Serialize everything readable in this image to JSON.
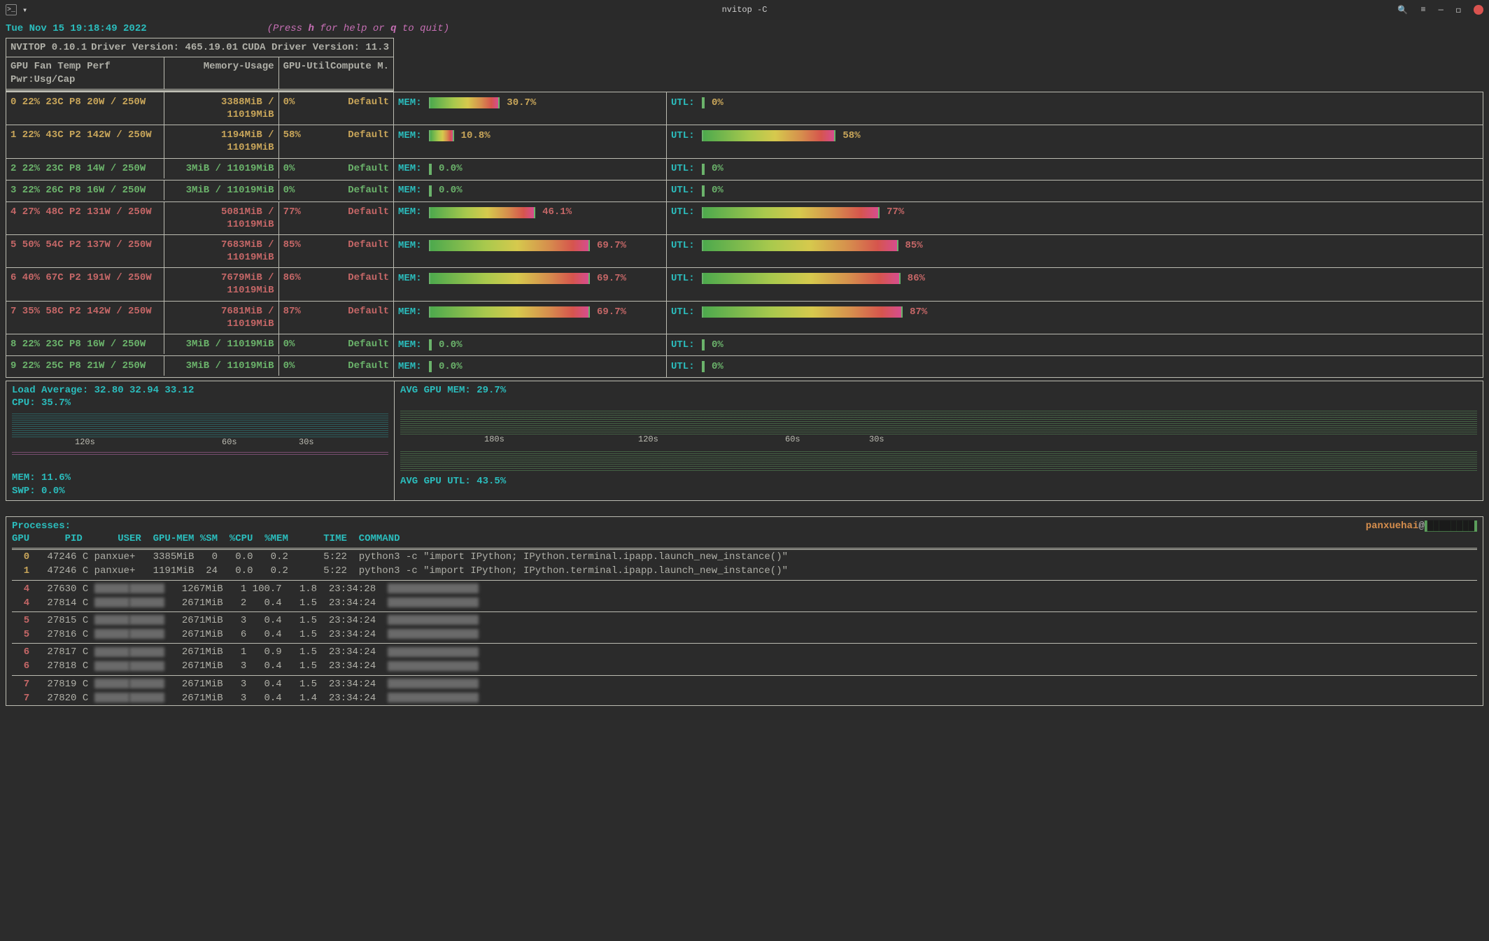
{
  "window": {
    "title": "nvitop -C"
  },
  "header": {
    "datetime": "Tue Nov 15 19:18:49 2022",
    "help": "(Press h for help or q to quit)",
    "help_pre": "(Press ",
    "help_h": "h",
    "help_mid": " for help or ",
    "help_q": "q",
    "help_post": " to quit)"
  },
  "versions": {
    "nvitop": "NVITOP 0.10.1",
    "driver": "Driver Version: 465.19.01",
    "cuda": "CUDA Driver Version: 11.3"
  },
  "gpu_cols": {
    "a": "GPU Fan Temp Perf Pwr:Usg/Cap",
    "b": "Memory-Usage",
    "c": "GPU-Util  Compute M."
  },
  "gpus": [
    {
      "idx": "0",
      "fan": "22%",
      "temp": "23C",
      "perf": "P8",
      "pwr": "20W / 250W",
      "mem": "3388MiB / 11019MiB",
      "util": "0%",
      "cm": "Default",
      "mempct": 30.7,
      "utlpct": 0,
      "color": "yellow6"
    },
    {
      "idx": "1",
      "fan": "22%",
      "temp": "43C",
      "perf": "P2",
      "pwr": "142W / 250W",
      "mem": "1194MiB / 11019MiB",
      "util": "58%",
      "cm": "Default",
      "mempct": 10.8,
      "utlpct": 58,
      "color": "yellow6"
    },
    {
      "idx": "2",
      "fan": "22%",
      "temp": "23C",
      "perf": "P8",
      "pwr": "14W / 250W",
      "mem": "3MiB / 11019MiB",
      "util": "0%",
      "cm": "Default",
      "mempct": 0.0,
      "utlpct": 0,
      "color": "green6"
    },
    {
      "idx": "3",
      "fan": "22%",
      "temp": "26C",
      "perf": "P8",
      "pwr": "16W / 250W",
      "mem": "3MiB / 11019MiB",
      "util": "0%",
      "cm": "Default",
      "mempct": 0.0,
      "utlpct": 0,
      "color": "green6"
    },
    {
      "idx": "4",
      "fan": "27%",
      "temp": "48C",
      "perf": "P2",
      "pwr": "131W / 250W",
      "mem": "5081MiB / 11019MiB",
      "util": "77%",
      "cm": "Default",
      "mempct": 46.1,
      "utlpct": 77,
      "color": "red6"
    },
    {
      "idx": "5",
      "fan": "50%",
      "temp": "54C",
      "perf": "P2",
      "pwr": "137W / 250W",
      "mem": "7683MiB / 11019MiB",
      "util": "85%",
      "cm": "Default",
      "mempct": 69.7,
      "utlpct": 85,
      "color": "red6"
    },
    {
      "idx": "6",
      "fan": "40%",
      "temp": "67C",
      "perf": "P2",
      "pwr": "191W / 250W",
      "mem": "7679MiB / 11019MiB",
      "util": "86%",
      "cm": "Default",
      "mempct": 69.7,
      "utlpct": 86,
      "color": "red6"
    },
    {
      "idx": "7",
      "fan": "35%",
      "temp": "58C",
      "perf": "P2",
      "pwr": "142W / 250W",
      "mem": "7681MiB / 11019MiB",
      "util": "87%",
      "cm": "Default",
      "mempct": 69.7,
      "utlpct": 87,
      "color": "red6"
    },
    {
      "idx": "8",
      "fan": "22%",
      "temp": "23C",
      "perf": "P8",
      "pwr": "16W / 250W",
      "mem": "3MiB / 11019MiB",
      "util": "0%",
      "cm": "Default",
      "mempct": 0.0,
      "utlpct": 0,
      "color": "green6"
    },
    {
      "idx": "9",
      "fan": "22%",
      "temp": "25C",
      "perf": "P8",
      "pwr": "21W / 250W",
      "mem": "3MiB / 11019MiB",
      "util": "0%",
      "cm": "Default",
      "mempct": 0.0,
      "utlpct": 0,
      "color": "green6"
    }
  ],
  "sys": {
    "load": "Load Average: 32.80 32.94 33.12",
    "cpu": "CPU: 35.7%",
    "mem": "MEM: 11.6%",
    "swp": "SWP: 0.0%",
    "avgmem": "AVG GPU MEM: 29.7%",
    "avgutl": "AVG GPU UTL: 43.5%",
    "axis_left": {
      "m120": "120s",
      "m60": "60s",
      "m30": "30s"
    },
    "axis_right": {
      "m180": "180s",
      "m120": "120s",
      "m60": "60s",
      "m30": "30s"
    }
  },
  "proc": {
    "title": "Processes:",
    "user": "panxuehai",
    "host": "████████",
    "cols": "GPU      PID      USER  GPU-MEM %SM  %CPU  %MEM      TIME  COMMAND",
    "rows": [
      {
        "gpu": "0",
        "color": "yellow6",
        "pid": "47246",
        "type": "C",
        "user": "panxue+",
        "gm": "3385MiB",
        "sm": "0",
        "cpu": "0.0",
        "mem": "0.2",
        "time": "5:22",
        "cmd": "python3 -c \"import IPython; IPython.terminal.ipapp.launch_new_instance()\""
      },
      {
        "gpu": "1",
        "color": "yellow6",
        "pid": "47246",
        "type": "C",
        "user": "panxue+",
        "gm": "1191MiB",
        "sm": "24",
        "cpu": "0.0",
        "mem": "0.2",
        "time": "5:22",
        "cmd": "python3 -c \"import IPython; IPython.terminal.ipapp.launch_new_instance()\""
      },
      {
        "gpu": "4",
        "color": "red6",
        "pid": "27630",
        "type": "C",
        "user": "*",
        "gm": "1267MiB",
        "sm": "1",
        "cpu": "100.7",
        "mem": "1.8",
        "time": "23:34:28",
        "cmd": "*"
      },
      {
        "gpu": "4",
        "color": "red6",
        "pid": "27814",
        "type": "C",
        "user": "*",
        "gm": "2671MiB",
        "sm": "2",
        "cpu": "0.4",
        "mem": "1.5",
        "time": "23:34:24",
        "cmd": "*"
      },
      {
        "gpu": "5",
        "color": "red6",
        "pid": "27815",
        "type": "C",
        "user": "*",
        "gm": "2671MiB",
        "sm": "3",
        "cpu": "0.4",
        "mem": "1.5",
        "time": "23:34:24",
        "cmd": "*"
      },
      {
        "gpu": "5",
        "color": "red6",
        "pid": "27816",
        "type": "C",
        "user": "*",
        "gm": "2671MiB",
        "sm": "6",
        "cpu": "0.4",
        "mem": "1.5",
        "time": "23:34:24",
        "cmd": "*"
      },
      {
        "gpu": "6",
        "color": "red6",
        "pid": "27817",
        "type": "C",
        "user": "*",
        "gm": "2671MiB",
        "sm": "1",
        "cpu": "0.9",
        "mem": "1.5",
        "time": "23:34:24",
        "cmd": "*"
      },
      {
        "gpu": "6",
        "color": "red6",
        "pid": "27818",
        "type": "C",
        "user": "*",
        "gm": "2671MiB",
        "sm": "3",
        "cpu": "0.4",
        "mem": "1.5",
        "time": "23:34:24",
        "cmd": "*"
      },
      {
        "gpu": "7",
        "color": "red6",
        "pid": "27819",
        "type": "C",
        "user": "*",
        "gm": "2671MiB",
        "sm": "3",
        "cpu": "0.4",
        "mem": "1.5",
        "time": "23:34:24",
        "cmd": "*"
      },
      {
        "gpu": "7",
        "color": "red6",
        "pid": "27820",
        "type": "C",
        "user": "*",
        "gm": "2671MiB",
        "sm": "3",
        "cpu": "0.4",
        "mem": "1.4",
        "time": "23:34:24",
        "cmd": "*"
      }
    ],
    "separators_after": [
      1,
      3,
      5,
      7
    ]
  },
  "bar": {
    "mem_label": "MEM:",
    "utl_label": "UTL:"
  }
}
